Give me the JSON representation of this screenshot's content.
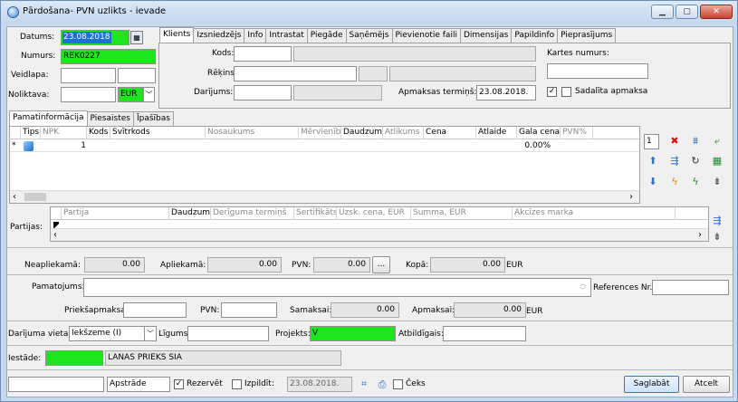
{
  "window": {
    "title": "Pārdošana- PVN uzlikts - ievade"
  },
  "header": {
    "datums_label": "Datums:",
    "datums_value": "23.08.2018",
    "numurs_label": "Numurs:",
    "numurs_value": "REK0227",
    "veidlapa_label": "Veidlapa:",
    "noliktava_label": "Noliktava:",
    "currency": "EUR"
  },
  "client_tabs": [
    "Klients",
    "Izsniedzējs",
    "Info",
    "Intrastat",
    "Piegāde",
    "Saņēmējs",
    "Pievienotie faili",
    "Dimensijas",
    "Papildinfo",
    "Pieprasījums"
  ],
  "client": {
    "kods_label": "Kods:",
    "rekins_label": "Rēķins:",
    "darijums_label": "Darījums:",
    "apmaksas_label": "Apmaksas termiņš:",
    "apmaksas_value": "23.08.2018.",
    "kartes_label": "Kartes numurs:",
    "sadalita_label": "Sadalīta apmaksa"
  },
  "main_tabs": [
    "Pamatinformācija",
    "Piesaistes",
    "Īpašības"
  ],
  "grid": {
    "columns": [
      "Tips",
      "NPK",
      "Kods",
      "Svītrkods",
      "Nosaukums",
      "Mērvienība",
      "Daudzums",
      "Atlikums",
      "Cena",
      "Atlaide",
      "Gala cena",
      "PVN%"
    ],
    "row": {
      "marker": "*",
      "npk": "1",
      "atlaide": "0.00%"
    },
    "page_value": "1"
  },
  "partijas": {
    "label": "Partijas:",
    "columns": [
      "Partija",
      "Daudzums",
      "Derīguma termiņš",
      "Sertifikāts",
      "Uzsk. cena, EUR",
      "Summa, EUR",
      "Akcīzes marka"
    ]
  },
  "totals": {
    "neapliekama_label": "Neapliekamā:",
    "neapliekama_value": "0.00",
    "apliekama_label": "Apliekamā:",
    "apliekama_value": "0.00",
    "pvn_label": "PVN:",
    "pvn_value": "0.00",
    "dots": "...",
    "kopa_label": "Kopā:",
    "kopa_value": "0.00",
    "currency": "EUR"
  },
  "pamatojums_label": "Pamatojums:",
  "references_label": "References Nr.:",
  "prepay": {
    "priekšapmaksa_label": "Priekšapmaksa:",
    "pvn_label": "PVN:",
    "samaksai_label": "Samaksai:",
    "samaksai_value": "0.00",
    "apmaksai_label": "Apmaksai:",
    "apmaksai_value": "0.00",
    "currency": "EUR"
  },
  "deal": {
    "vieta_label": "Darījuma vieta:",
    "vieta_value": "Iekšzeme (I)",
    "ligums_label": "Līgums:",
    "projekts_label": "Projekts:",
    "projekts_value": "V",
    "atbildigais_label": "Atbildīgais:"
  },
  "iestade": {
    "label": "Iestāde:",
    "name": "LANAS PRIEKS SIA"
  },
  "footer": {
    "apstrade": "Apstrāde",
    "rezervet": "Rezervēt",
    "izpildit": "Izpildīt:",
    "izpildit_date": "23.08.2018.",
    "ceks": "Čeks",
    "save": "Saglabāt",
    "cancel": "Atcelt"
  }
}
